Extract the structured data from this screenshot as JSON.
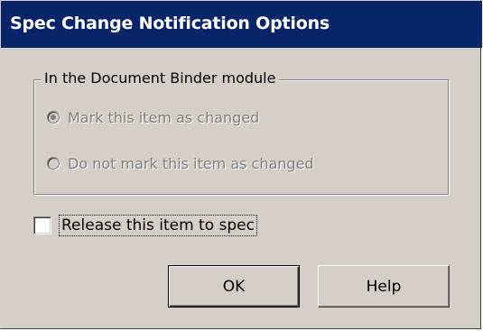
{
  "window": {
    "title": "Spec Change Notification Options"
  },
  "group": {
    "legend": "In the Document Binder module",
    "options": [
      {
        "label": "Mark this item as changed",
        "checked": true,
        "enabled": false
      },
      {
        "label": "Do not mark this item as changed",
        "checked": false,
        "enabled": false
      }
    ]
  },
  "release": {
    "label": "Release this item to spec",
    "checked": false
  },
  "buttons": {
    "ok_label": "OK",
    "help_label": "Help"
  },
  "colors": {
    "titlebar": "#0a246a",
    "dialog_face": "#d4d0c8",
    "disabled_text": "#808080"
  }
}
